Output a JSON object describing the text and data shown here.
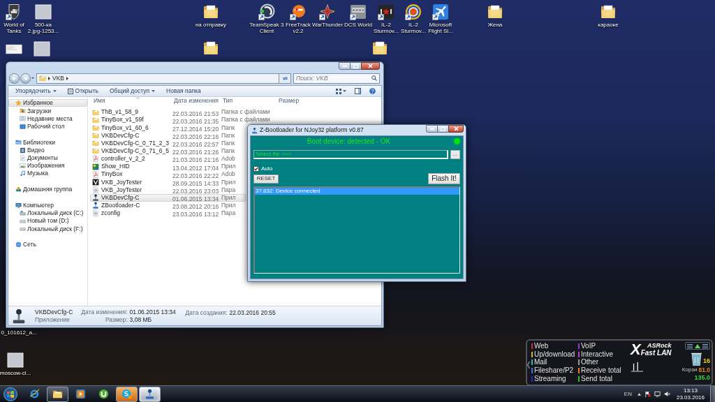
{
  "desktop_icons": [
    {
      "label": "World of Tanks",
      "kind": "tank",
      "shortcut": true
    },
    {
      "label": "500-ка 2.jpg-1253...",
      "kind": "photo",
      "shortcut": false
    },
    {
      "label": "на отправку",
      "kind": "folder",
      "shortcut": false
    },
    {
      "label": "TeamSpeak 3 Client",
      "kind": "teamspeak",
      "shortcut": true
    },
    {
      "label": "FreeTrack v2.2",
      "kind": "freetrack",
      "shortcut": true
    },
    {
      "label": "WarThunder",
      "kind": "warthunder",
      "shortcut": true
    },
    {
      "label": "DCS World",
      "kind": "dcs",
      "shortcut": true
    },
    {
      "label": "IL-2 Sturmov...",
      "kind": "il2",
      "shortcut": true
    },
    {
      "label": "IL-2 Sturmov...",
      "kind": "roundel",
      "shortcut": true
    },
    {
      "label": "Microsoft Flight Si...",
      "kind": "plane",
      "shortcut": true
    },
    {
      "label": "Жена",
      "kind": "folder",
      "shortcut": false
    },
    {
      "label": "караоке",
      "kind": "folder",
      "shortcut": false
    },
    {
      "kind": "screenshot",
      "shortcut": false
    },
    {
      "kind": "photo",
      "shortcut": false
    },
    {
      "kind": "folder",
      "shortcut": false
    },
    {
      "kind": "folder",
      "shortcut": false
    },
    {
      "label": "0_101612_a..."
    },
    {
      "label": "moscow-ci...",
      "kind": "photo",
      "shortcut": false
    }
  ],
  "explorer": {
    "path": [
      "VKB"
    ],
    "search": {
      "placeholder": "Поиск: VKB"
    },
    "toolbar": [
      {
        "label": "Упорядочить",
        "icon": false,
        "dropdown": true
      },
      {
        "label": "Открыть",
        "icon": true,
        "dropdown": false
      },
      {
        "label": "Общий доступ",
        "icon": false,
        "dropdown": true
      },
      {
        "label": "Новая папка",
        "icon": false,
        "dropdown": false
      }
    ],
    "nav": [
      {
        "label": "Избранное",
        "kind": "star",
        "selected": true,
        "children": [
          {
            "label": "Загрузки",
            "kind": "downloads",
            "selected": false
          },
          {
            "label": "Недавние места",
            "kind": "recent",
            "selected": false
          },
          {
            "label": "Рабочий стол",
            "kind": "desktop",
            "selected": false
          }
        ]
      },
      {
        "label": "Библиотеки",
        "kind": "library",
        "selected": false,
        "children": [
          {
            "label": "Видео",
            "kind": "video",
            "selected": false
          },
          {
            "label": "Документы",
            "kind": "documents",
            "selected": false
          },
          {
            "label": "Изображения",
            "kind": "pictures",
            "selected": false
          },
          {
            "label": "Музыка",
            "kind": "music",
            "selected": false
          }
        ]
      },
      {
        "label": "Домашняя группа",
        "kind": "homegroup",
        "selected": false
      },
      {
        "label": "Компьютер",
        "kind": "computer",
        "selected": false,
        "children": [
          {
            "label": "Локальный диск (C:)",
            "kind": "system_drive",
            "selected": false
          },
          {
            "label": "Новый том (D:)",
            "kind": "drive",
            "selected": false
          },
          {
            "label": "Локальный диск (F:)",
            "kind": "drive",
            "selected": false
          }
        ]
      },
      {
        "label": "Сеть",
        "kind": "network",
        "selected": false
      }
    ],
    "columns": [
      "Имя",
      "Дата изменения",
      "Тип",
      "Размер"
    ],
    "files": [
      {
        "name": "ThB_v1_58_9",
        "date": "22.03.2016 21:53",
        "type": "Папка с файлами",
        "kind": "folder",
        "selected": false
      },
      {
        "name": "TinyBox_v1_59f",
        "date": "22.03.2016 21:35",
        "type": "Папка с файлами",
        "kind": "folder",
        "selected": false
      },
      {
        "name": "TinyBox_v1_60_6",
        "date": "27.12.2014 15:20",
        "type": "Папк",
        "kind": "folder",
        "selected": false
      },
      {
        "name": "VKBDevCfg-C",
        "date": "22.03.2016 22:16",
        "type": "Папк",
        "kind": "folder",
        "selected": false
      },
      {
        "name": "VKBDevCfg-C_0_71_2_3",
        "date": "22.03.2016 22:57",
        "type": "Папк",
        "kind": "folder",
        "selected": false
      },
      {
        "name": "VKBDevCfg-C_0_71_6_5",
        "date": "22.03.2016 21:26",
        "type": "Папк",
        "kind": "folder",
        "selected": false
      },
      {
        "name": "controller_v_2_2",
        "date": "21.03.2016 21:16",
        "type": "Adob",
        "kind": "pdf",
        "selected": false
      },
      {
        "name": "Show_HID",
        "date": "13.04.2012 17:04",
        "type": "Прил",
        "kind": "app",
        "selected": false
      },
      {
        "name": "TinyBox",
        "date": "22.03.2016 22:22",
        "type": "Adob",
        "kind": "pdf",
        "selected": false
      },
      {
        "name": "VKB_JoyTester",
        "date": "28.09.2015 14:33",
        "type": "Прил",
        "kind": "vkb",
        "selected": false
      },
      {
        "name": "VKB_JoyTester",
        "date": "22.03.2016 23:03",
        "type": "Пара",
        "kind": "config",
        "selected": false
      },
      {
        "name": "VKBDevCfg-C",
        "date": "01.06.2015 13:34",
        "type": "Прил",
        "kind": "joystick",
        "selected": true
      },
      {
        "name": "ZBootloader-C",
        "date": "23.08.2012 20:16",
        "type": "Прил",
        "kind": "zboot",
        "selected": false
      },
      {
        "name": "zconfig",
        "date": "23.03.2016 13:12",
        "type": "Пара",
        "kind": "config",
        "selected": false
      }
    ],
    "details": {
      "name": "VKBDevCfg-C",
      "type": "Приложение",
      "fields": [
        {
          "label": "Дата изменения:",
          "value": "01.06.2015 13:34"
        },
        {
          "label": "Размер:",
          "value": "3,08 МБ"
        },
        {
          "label": "Дата создания:",
          "value": "22.03.2016 20:55"
        }
      ]
    }
  },
  "bootloader": {
    "title": "Z-Bootloader for NJoy32 platform v0.87",
    "status": "Boot device: detected - OK",
    "connected": true,
    "file_field": {
      "value": "Select file >>>"
    },
    "browse_button": "...",
    "auto": {
      "label": "Auto",
      "checked": true
    },
    "reset_button": "RESET",
    "flash_button": "Flash It!",
    "log": [
      {
        "text": "37.832: Device connected",
        "selected": true
      }
    ]
  },
  "network_gadget": {
    "logo_mark": "X",
    "brand": "ASRock",
    "product": "Fast LAN",
    "categories": [
      {
        "label": "Web",
        "color": "#d42a2a"
      },
      {
        "label": "VoIP",
        "color": "#8a3ed6"
      },
      {
        "label": "Up/download",
        "color": "#c8c21c"
      },
      {
        "label": "Interactive",
        "color": "#c03bc8"
      },
      {
        "label": "Mail",
        "color": "#2ab8b0"
      },
      {
        "label": "Other",
        "color": "#9a9a9a"
      },
      {
        "label": "Fileshare/P2",
        "color": "#3a7ad6"
      },
      {
        "label": "Receive total",
        "color": "#e8801a"
      },
      {
        "label": "Streaming",
        "color": "#1c2ad0"
      },
      {
        "label": "Send total",
        "color": "#2ec02e"
      }
    ],
    "recycle_bin_label": "Корзи",
    "readings": [
      "16",
      "81.0",
      "135.0"
    ]
  },
  "taskbar": {
    "apps": [
      {
        "kind": "ie",
        "running": false,
        "active": false,
        "flashing": false
      },
      {
        "kind": "explorer",
        "running": true,
        "active": false,
        "flashing": false
      },
      {
        "kind": "media",
        "running": false,
        "active": false,
        "flashing": false
      },
      {
        "kind": "torrent",
        "running": false,
        "active": false,
        "flashing": false
      },
      {
        "kind": "skype",
        "running": true,
        "active": false,
        "flashing": true
      },
      {
        "kind": "joystick",
        "running": true,
        "active": true,
        "flashing": false
      }
    ],
    "language": "EN",
    "time": "13:13",
    "date": "23.03.2016"
  }
}
